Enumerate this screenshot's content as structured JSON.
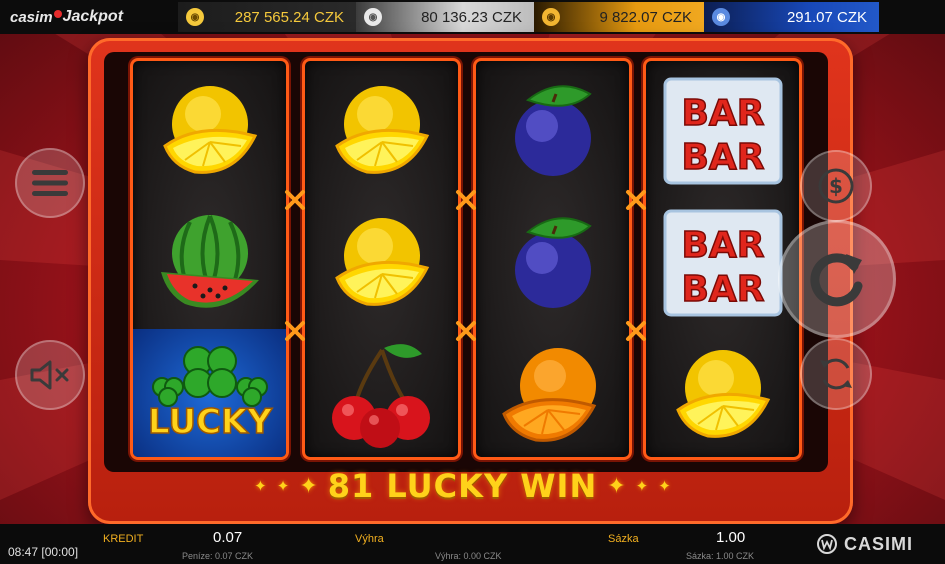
{
  "jackpot": {
    "logo_part1": "casim",
    "logo_part2": "Jackpot",
    "tiles": [
      {
        "tier": "gold",
        "amount": "287 565.24 CZK",
        "color": "#f5c93c",
        "icon": "jackpot-coin-icon"
      },
      {
        "tier": "silver",
        "amount": "80 136.23 CZK",
        "color": "#d8d8d8",
        "icon": "jackpot-coin-icon"
      },
      {
        "tier": "bronze",
        "amount": "9 822.07 CZK",
        "color": "#e69a10",
        "icon": "jackpot-coin-icon"
      },
      {
        "tier": "blue",
        "amount": "291.07 CZK",
        "color": "#1848b8",
        "icon": "jackpot-coin-icon"
      }
    ]
  },
  "reels": [
    {
      "symbols": [
        "lemon",
        "watermelon",
        "lucky"
      ]
    },
    {
      "symbols": [
        "lemon",
        "lemon",
        "cherries"
      ]
    },
    {
      "symbols": [
        "plum",
        "plum",
        "orange"
      ]
    },
    {
      "symbols": [
        "bar",
        "bar",
        "lemon"
      ]
    }
  ],
  "symbols": {
    "lucky_text": "LUCKY",
    "bar_line1": "BAR",
    "bar_line2": "BAR"
  },
  "win": {
    "text": "81 LUCKY WIN"
  },
  "controls": {
    "menu_icon": "hamburger-menu-icon",
    "sound_icon": "speaker-muted-icon",
    "bet_icon": "dollar-coin-icon",
    "spin_icon": "spin-arrow-icon",
    "autoplay_icon": "autoplay-arrows-icon"
  },
  "bottom_bar": {
    "clock": "08:47 [00:00]",
    "credit_label": "KREDIT",
    "credit_value": "0.07",
    "credit_sub": "Peníze: 0.07 CZK",
    "win_label": "Výhra",
    "win_sub": "Výhra: 0.00 CZK",
    "bet_label": "Sázka",
    "bet_value": "1.00",
    "bet_sub": "Sázka: 1.00 CZK",
    "brand": "CASIMI"
  },
  "colors": {
    "frame": "#e0341c",
    "reel_border": "#ff5a16",
    "win_text": "#ffd21a",
    "label_gold": "#f2b020"
  }
}
